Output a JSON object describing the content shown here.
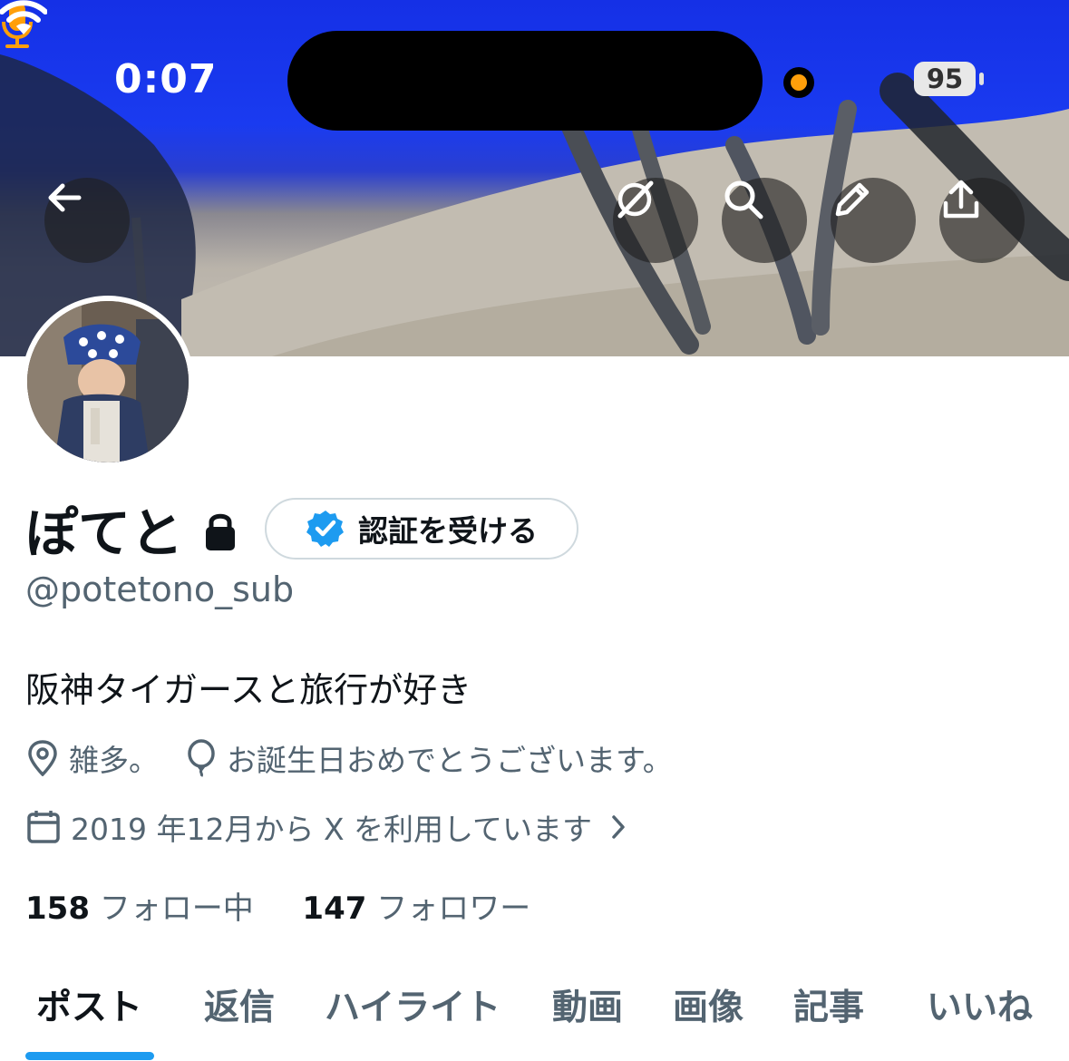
{
  "status_bar": {
    "time": "0:07",
    "battery": "95"
  },
  "header_icons": [
    "back-arrow-icon",
    "grok-icon",
    "search-icon",
    "pencil-icon",
    "share-icon"
  ],
  "profile": {
    "name": "ぽてと",
    "verify_label": "認証を受ける",
    "handle": "@potetono_sub",
    "bio": "阪神タイガースと旅行が好き",
    "location": "雑多。",
    "birthday": "お誕生日おめでとうございます。",
    "joined": "2019 年12月から X を利用しています",
    "following_count": "158",
    "following_label": "フォロー中",
    "followers_count": "147",
    "followers_label": "フォロワー"
  },
  "tabs": [
    {
      "label": "ポスト",
      "active": true
    },
    {
      "label": "返信"
    },
    {
      "label": "ハイライト"
    },
    {
      "label": "動画"
    },
    {
      "label": "画像"
    },
    {
      "label": "記事"
    },
    {
      "label": "いいね"
    }
  ],
  "colors": {
    "accent": "#1d9bf0",
    "secondary_text": "#536471",
    "primary_text": "#0f1419",
    "mic": "#ff9f0a"
  }
}
